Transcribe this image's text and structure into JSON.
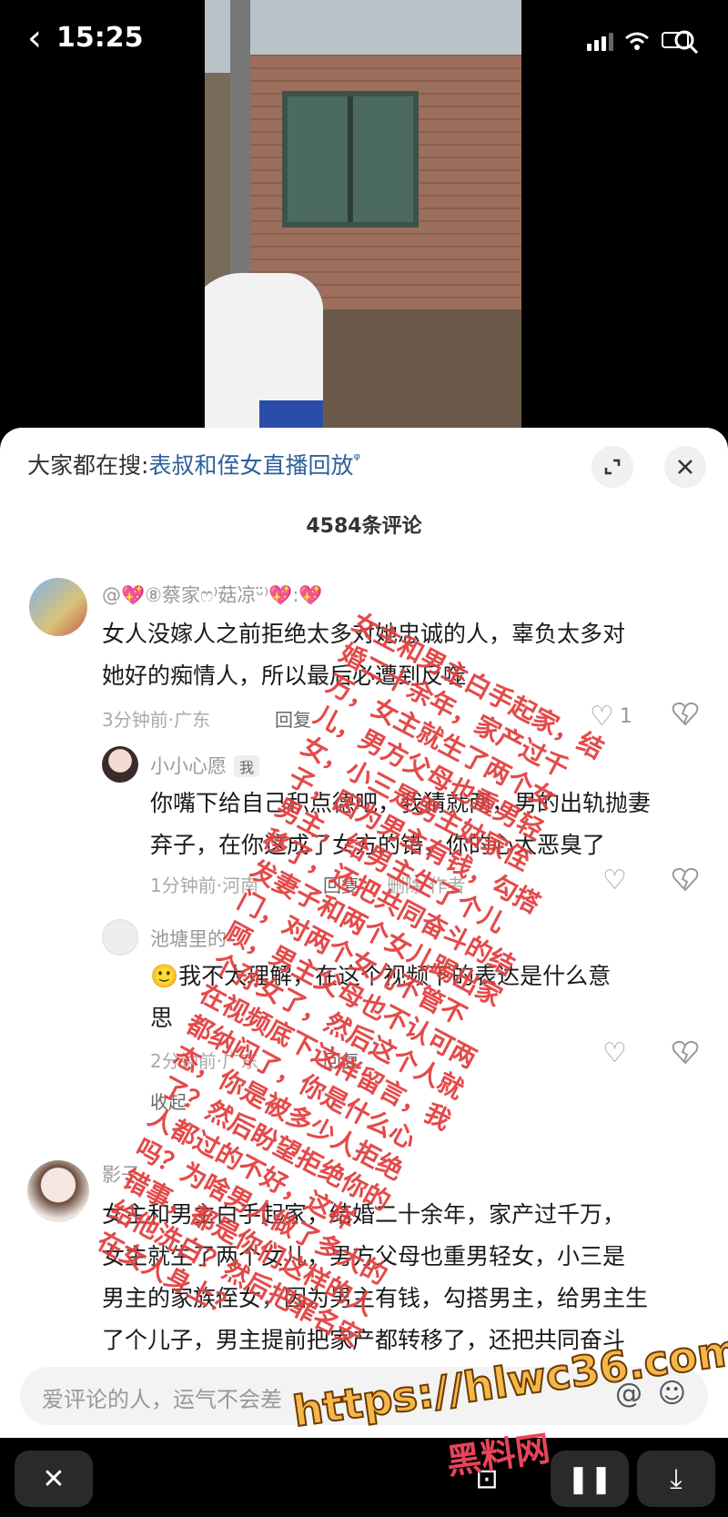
{
  "status_bar": {
    "back_glyph": "‹",
    "time": "15:25"
  },
  "search": {
    "prefix": "大家都在搜:",
    "keyword": "表叔和侄女直播回放",
    "search_glyph": "ᵠ"
  },
  "sheet": {
    "comment_count": "4584条评论"
  },
  "comments": [
    {
      "name": "@💖⑧蔡家ෆ⁾菇凉ᵕ̈⁾💖:💖",
      "text": [
        "女人没嫁人之前拒绝太多对她忠诚的人，辜负太多对",
        "她好的痴情人，所以最后必遭到反噬"
      ],
      "meta": "3分钟前·广东",
      "reply": "回复",
      "likes": "1"
    },
    {
      "name": "小小心愿",
      "badge": "我",
      "text": [
        "你嘴下给自己积点德吧，我猜就两，男的出轨抛妻",
        "弃子，在你这成了女方的错，你的心太恶臭了"
      ],
      "meta": "1分钟前·河南",
      "reply": "回复",
      "extra": "删除 作者"
    },
    {
      "name": "池塘里的",
      "text": [
        "🙂我不太理解，在这个视频下的表达是什么意",
        "思"
      ],
      "meta": "2分钟前·广东",
      "reply": "回复"
    },
    {
      "name": "影子",
      "collapse": "收起",
      "text": [
        "女主和男主白手起家，结婚二十余年，家产过千万，",
        "女主就生了两个女儿，男方父母也重男轻女，小三是",
        "男主的家族侄女，因为男主有钱，勾搭男主，给男主生",
        "了个儿子，男主提前把家产都转移了，还把共同奋斗"
      ]
    }
  ],
  "input": {
    "placeholder": "爱评论的人，运气不会差",
    "at_glyph": "@",
    "emoji_glyph": "☺"
  },
  "bottom_bar": {
    "close_glyph": "✕",
    "pause_glyph": "❚❚",
    "download_glyph": "⤓",
    "mid_glyph": "⊡"
  },
  "overlay_note": [
    "女主和男主白手起家，结",
    "婚二十余年，家产过千",
    "万，女主就生了两个女",
    "儿，男方父母也重男轻",
    "女，小三是男主姑家侄",
    "子，因为男主有钱，勾搭",
    "男主，给男主生了个儿",
    "移了，还把共同奋斗的结",
    "发妻子和两个女儿踢出家",
    "门，对两个女儿不管不",
    "顾，男主父母也不认可两",
    "个孙女了，然后这个人就",
    "在视频底下这样留言，我",
    "都纳闷了，你是什么心",
    "态，你是被多少人拒绝",
    "了？然后盼望拒绝你的",
    "人都过的不好，这样",
    "吗？为啥男人做了多大的",
    "错事，都是你们这样的人",
    "给他洗白？然后把罪名安",
    "在女人身上？"
  ],
  "watermark": {
    "url": "https://hlwc36.com",
    "site": "黑料网"
  },
  "colors": {
    "accent_red": "#e23b3b",
    "keyword_blue": "#2d5f9a",
    "watermark_orange": "#f5b64a"
  }
}
